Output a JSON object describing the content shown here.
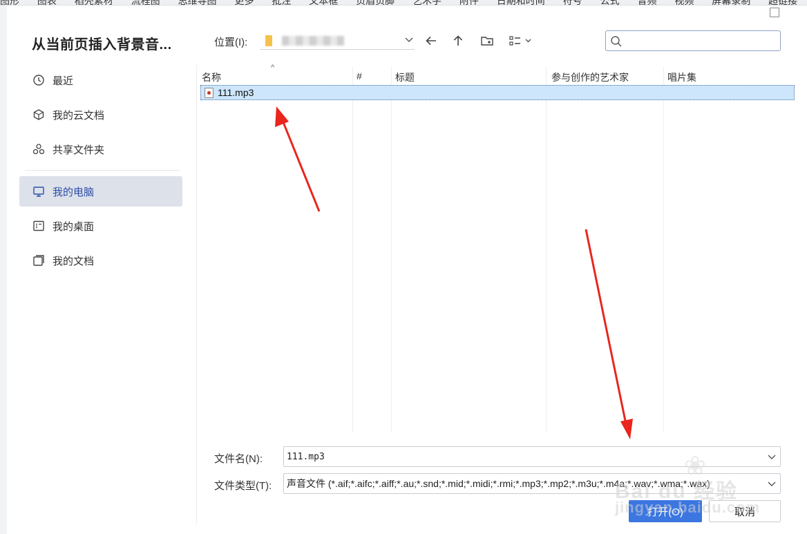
{
  "topbar": {
    "items": [
      "图形",
      "图表",
      "稻壳素材",
      "流程图",
      "思维导图",
      "更多",
      "批注",
      "文本框",
      "页眉页脚",
      "艺术字",
      "附件",
      "日期和时间",
      "符号",
      "公式",
      "音频",
      "视频",
      "屏幕录制",
      "超链接"
    ]
  },
  "dialog": {
    "title": "从当前页插入背景音..."
  },
  "sidebar": {
    "items": [
      {
        "label": "最近",
        "icon": "clock-icon"
      },
      {
        "label": "我的云文档",
        "icon": "cube-icon"
      },
      {
        "label": "共享文件夹",
        "icon": "share-folder-icon"
      },
      {
        "label": "我的电脑",
        "icon": "monitor-icon",
        "active": true
      },
      {
        "label": "我的桌面",
        "icon": "desktop-icon"
      },
      {
        "label": "我的文档",
        "icon": "documents-icon"
      }
    ]
  },
  "toolbar": {
    "location_label": "位置(I):",
    "search_placeholder": ""
  },
  "table": {
    "columns": [
      "名称",
      "#",
      "标题",
      "参与创作的艺术家",
      "唱片集"
    ],
    "rows": [
      {
        "name": "111.mp3",
        "selected": true
      }
    ]
  },
  "footer": {
    "filename_label": "文件名(N):",
    "filename_value": "111.mp3",
    "filetype_label": "文件类型(T):",
    "filetype_value": "声音文件 (*.aif;*.aifc;*.aiff;*.au;*.snd;*.mid;*.midi;*.rmi;*.mp3;*.mp2;*.m3u;*.m4a;*.wav;*.wma;*.wax)",
    "open_label": "打开(O)",
    "cancel_label": "取消"
  },
  "watermark": {
    "text": "Bai du 经验",
    "sub": "jingyan.baidu.com"
  },
  "colors": {
    "accent": "#3b76e1",
    "selection": "#cde6fb",
    "arrow": "#e8261d"
  }
}
